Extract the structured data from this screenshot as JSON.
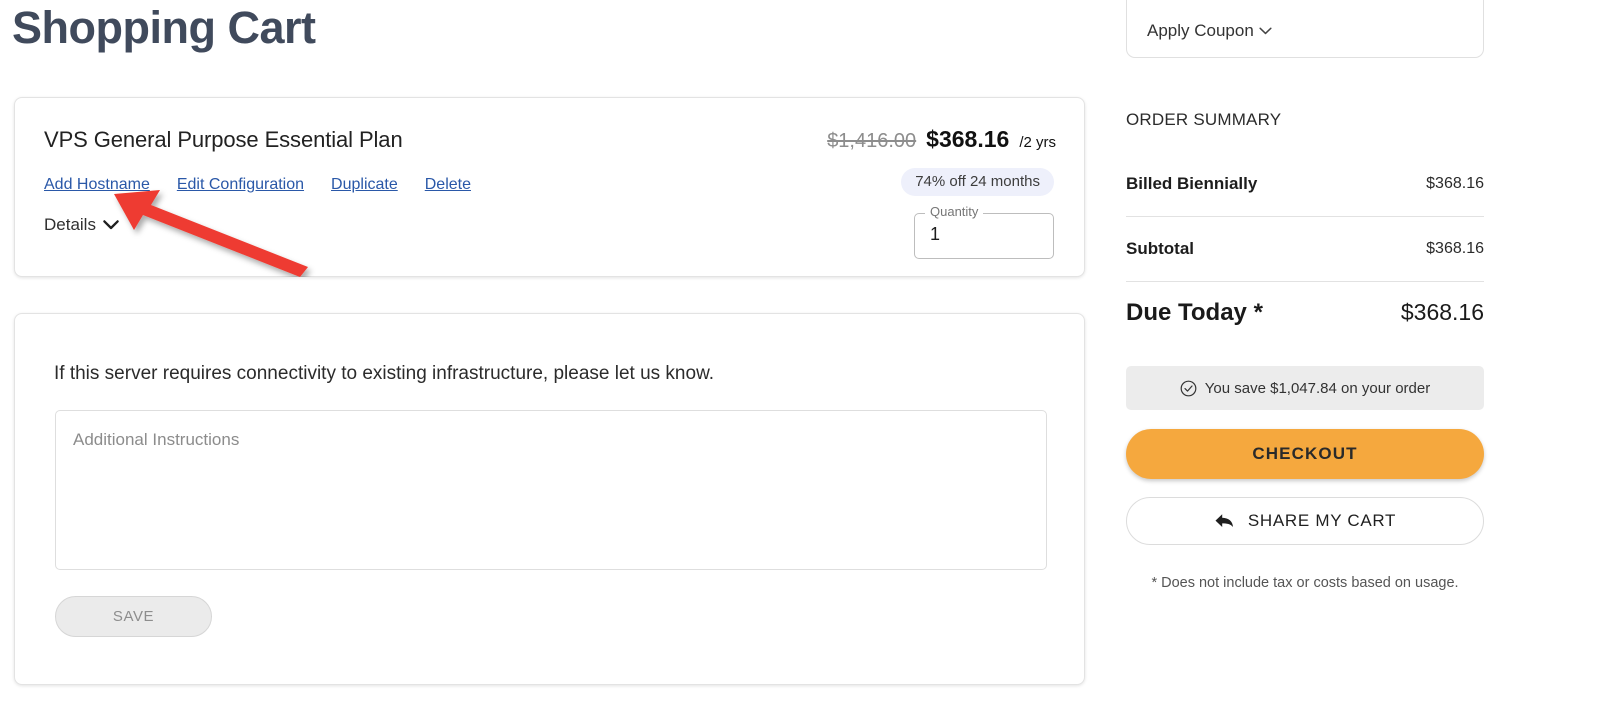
{
  "page": {
    "title": "Shopping Cart"
  },
  "product": {
    "name": "VPS General Purpose Essential Plan",
    "links": [
      {
        "label": "Add Hostname",
        "name": "add-hostname-link"
      },
      {
        "label": "Edit Configuration",
        "name": "edit-configuration-link"
      },
      {
        "label": "Duplicate",
        "name": "duplicate-link"
      },
      {
        "label": "Delete",
        "name": "delete-link"
      }
    ],
    "details_label": "Details",
    "price_original": "$1,416.00",
    "price_current": "$368.16",
    "price_term": "/2 yrs",
    "discount_badge": "74% off 24 months",
    "quantity_label": "Quantity",
    "quantity_value": "1"
  },
  "instructions": {
    "prompt": "If this server requires connectivity to existing infrastructure, please let us know.",
    "placeholder": "Additional Instructions",
    "value": "",
    "save_label": "SAVE"
  },
  "sidebar": {
    "coupon_label": "Apply Coupon",
    "summary_heading": "ORDER SUMMARY",
    "rows": [
      {
        "label": "Billed Biennially",
        "value": "$368.16"
      },
      {
        "label": "Subtotal",
        "value": "$368.16"
      }
    ],
    "due_label": "Due Today *",
    "due_value": "$368.16",
    "savings_text": "You save $1,047.84 on your order",
    "checkout_label": "CHECKOUT",
    "share_label": "SHARE MY CART",
    "footnote": "* Does not include tax or costs based on usage."
  },
  "annotation": {
    "arrow_color": "#ee3b30",
    "points_to": "add-hostname-link"
  },
  "colors": {
    "title": "#404a5c",
    "link": "#2a58a8",
    "checkout": "#f5a83e",
    "badge_bg": "#eef0fb",
    "savings_bg": "#ececec"
  }
}
